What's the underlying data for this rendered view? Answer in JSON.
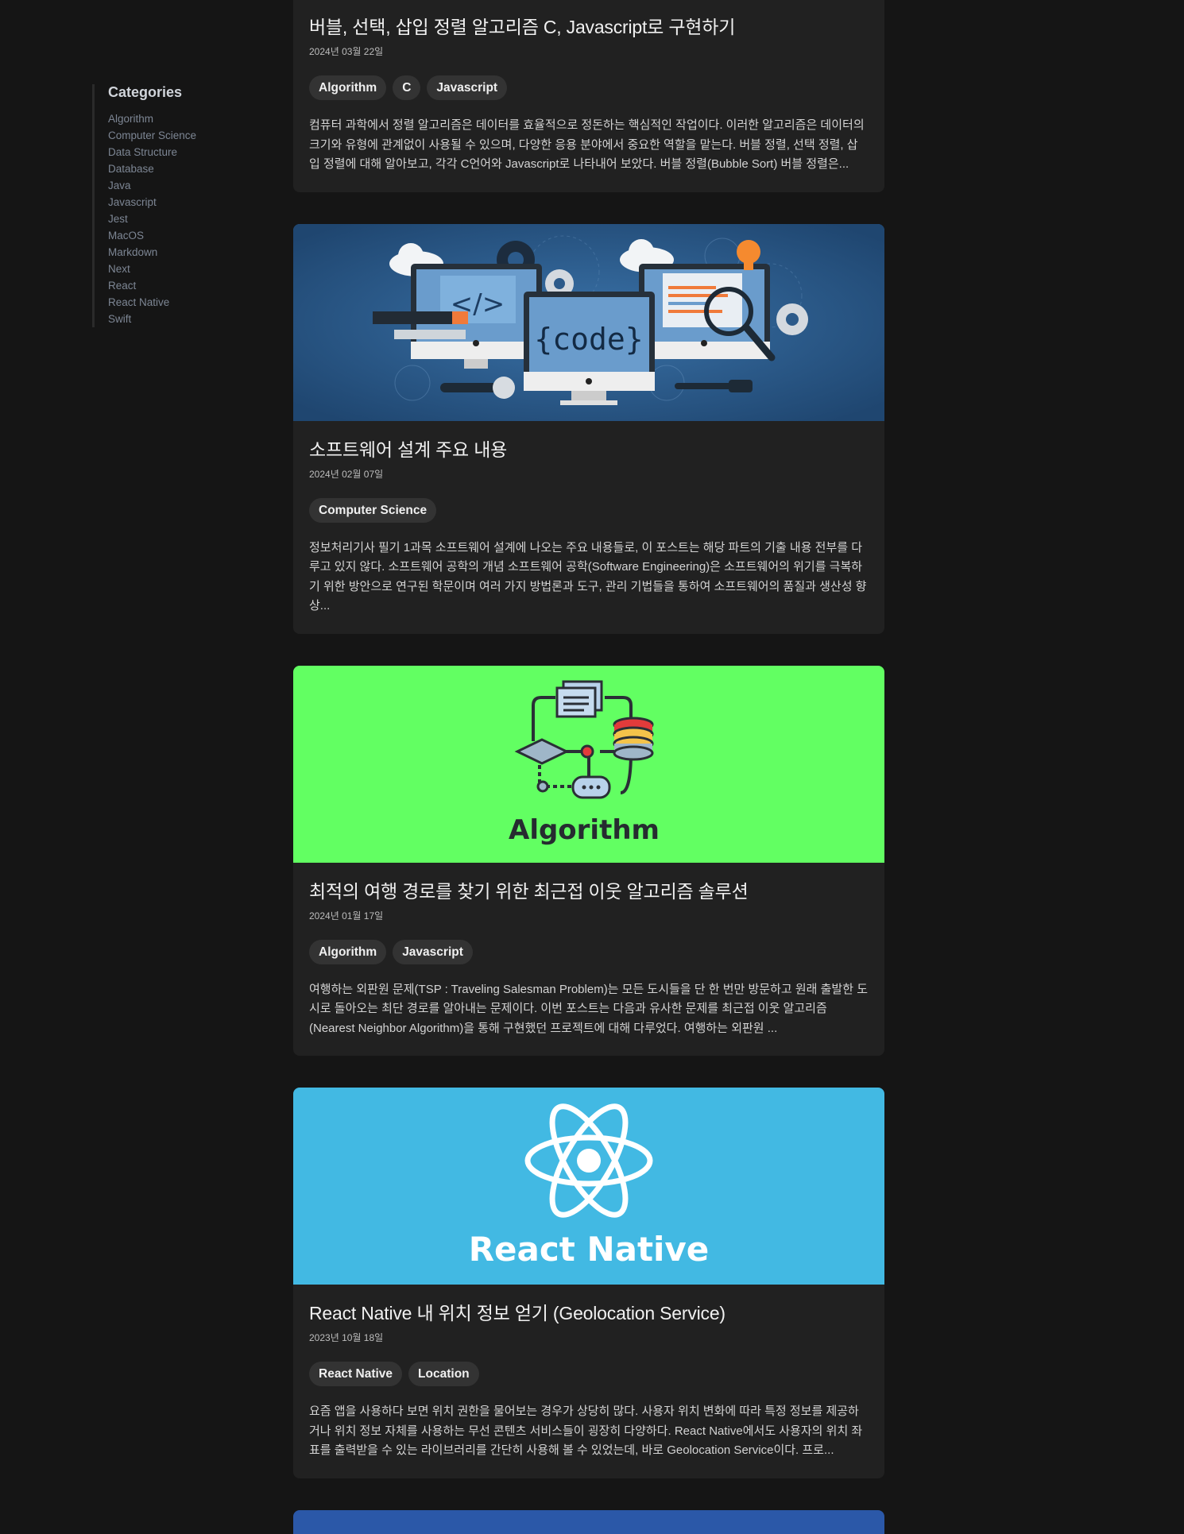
{
  "sidebar": {
    "title": "Categories",
    "items": [
      "Algorithm",
      "Computer Science",
      "Data Structure",
      "Database",
      "Java",
      "Javascript",
      "Jest",
      "MacOS",
      "Markdown",
      "Next",
      "React",
      "React Native",
      "Swift"
    ]
  },
  "posts": [
    {
      "title": "버블, 선택, 삽입 정렬 알고리즘 C, Javascript로 구현하기",
      "date": "2024년 03월 22일",
      "tags": [
        "Algorithm",
        "C",
        "Javascript"
      ],
      "excerpt": "컴퓨터 과학에서 정렬 알고리즘은 데이터를 효율적으로 정돈하는 핵심적인 작업이다. 이러한 알고리즘은 데이터의 크기와 유형에 관계없이 사용될 수 있으며, 다양한 응용 분야에서 중요한 역할을 맡는다. 버블 정렬, 선택 정렬, 삽입 정렬에 대해 알아보고, 각각 C언어와 Javascript로 나타내어 보았다. 버블 정렬(Bubble Sort) 버블 정렬은..."
    },
    {
      "title": "소프트웨어 설계 주요 내용",
      "date": "2024년 02월 07일",
      "tags": [
        "Computer Science"
      ],
      "excerpt": "정보처리기사 필기 1과목 소프트웨어 설계에 나오는 주요 내용들로, 이 포스트는 해당 파트의 기출 내용 전부를 다루고 있지 않다. 소프트웨어 공학의 개념 소프트웨어 공학(Software Engineering)은 소프트웨어의 위기를 극복하기 위한 방안으로 연구된 학문이며 여러 가지 방법론과 도구, 관리 기법들을 통하여 소프트웨어의 품질과 생산성 향상...",
      "image_text": "{code}"
    },
    {
      "title": "최적의 여행 경로를 찾기 위한 최근접 이웃 알고리즘 솔루션",
      "date": "2024년 01월 17일",
      "tags": [
        "Algorithm",
        "Javascript"
      ],
      "excerpt": "여행하는 외판원 문제(TSP : Traveling Salesman Problem)는 모든 도시들을 단 한 번만 방문하고 원래 출발한 도시로 돌아오는 최단 경로를 알아내는 문제이다. 이번 포스트는 다음과 유사한 문제를 최근접 이웃 알고리즘(Nearest Neighbor Algorithm)을 통해 구현했던 프로젝트에 대해 다루었다. 여행하는 외판원 ...",
      "image_text": "Algorithm"
    },
    {
      "title": "React Native 내 위치 정보 얻기 (Geolocation Service)",
      "date": "2023년 10월 18일",
      "tags": [
        "React Native",
        "Location"
      ],
      "excerpt": "요즘 앱을 사용하다 보면 위치 권한을 물어보는 경우가 상당히 많다. 사용자 위치 변화에 따라 특정 정보를 제공하거나 위치 정보 자체를 사용하는 무선 콘텐츠 서비스들이 굉장히 다양하다. React Native에서도 사용자의 위치 좌표를 출력받을 수 있는 라이브러리를 간단히 사용해 볼 수 있었는데, 바로 Geolocation Service이다. 프로...",
      "image_text": "React Native"
    }
  ],
  "colors": {
    "background": "#151515",
    "card": "#212121",
    "tag": "#333333",
    "algorithm_thumb": "#62ff62",
    "react_thumb": "#42b9e3",
    "code_thumb": "#2b5687",
    "next_thumb": "#2b58a8"
  }
}
